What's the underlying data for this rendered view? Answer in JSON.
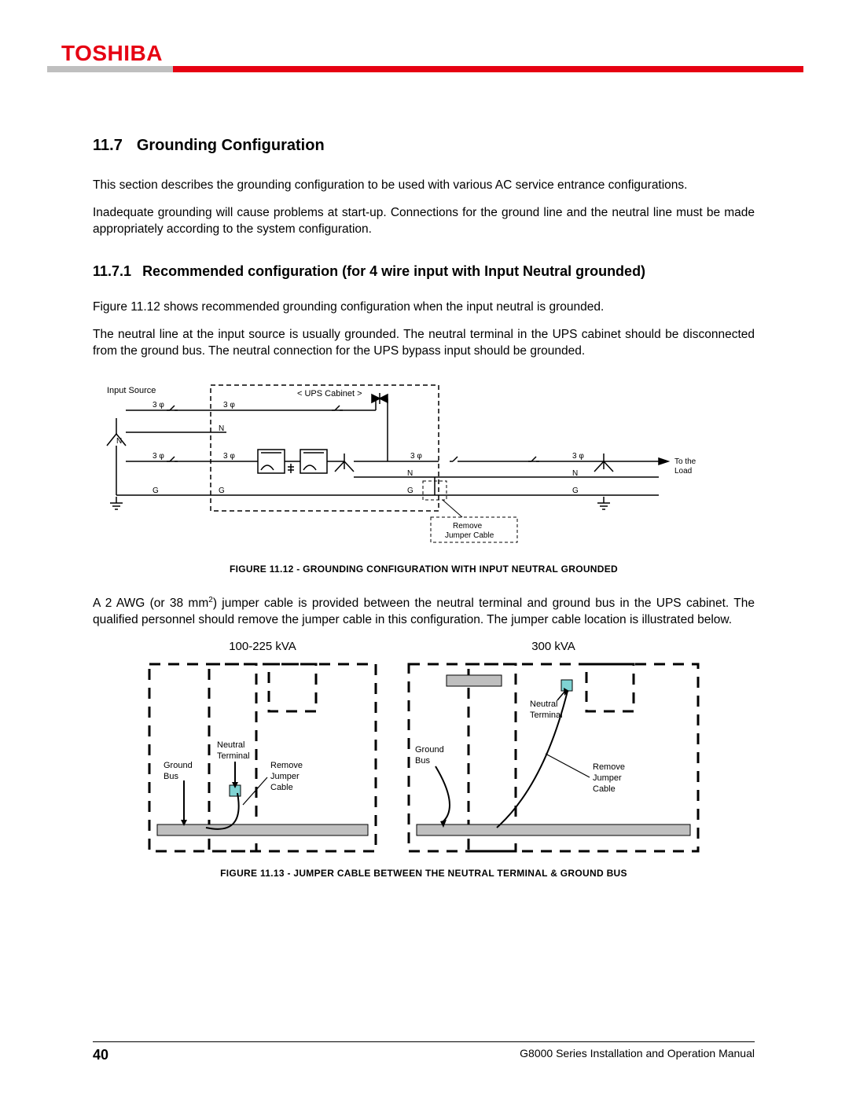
{
  "brand": "TOSHIBA",
  "section": {
    "number": "11.7",
    "title": "Grounding Configuration"
  },
  "subsection": {
    "number": "11.7.1",
    "title": "Recommended configuration (for 4 wire input with Input Neutral grounded)"
  },
  "para1": "This section describes the grounding configuration to be used with various AC service entrance configurations.",
  "para2": "Inadequate grounding will cause problems at start-up. Connections for the ground line and the neutral line must be made appropriately according to the system configuration.",
  "para3": "Figure 11.12 shows recommended grounding configuration when the input neutral is grounded.",
  "para4": "The neutral line at the input source is usually grounded. The neutral terminal in the UPS cabinet should be disconnected from the ground bus. The neutral connection for the UPS bypass input should be grounded.",
  "fig12caption": "FIGURE 11.12 - GROUNDING CONFIGURATION WITH INPUT NEUTRAL GROUNDED",
  "para5a": "A 2 AWG (or 38 mm",
  "para5b": ") jumper cable is provided between the neutral terminal and ground bus in the UPS cabinet. The qualified personnel should remove the jumper cable in this configuration. The jumper cable location is illustrated below.",
  "sup2": "2",
  "fig13caption": "FIGURE 11.13 - JUMPER CABLE BETWEEN THE NEUTRAL TERMINAL & GROUND BUS",
  "fig12": {
    "inputSource": "Input Source",
    "upsCabinet": "< UPS Cabinet >",
    "toLoad1": "To the",
    "toLoad2": "Load",
    "removeJumper1": "Remove",
    "removeJumper2": "Jumper Cable",
    "phi": "φ",
    "three": "3",
    "N": "N",
    "G": "G"
  },
  "fig13": {
    "left_kva": "100-225 kVA",
    "right_kva": "300 kVA",
    "groundBus": "Ground\nBus",
    "neutralTerminal": "Neutral\nTerminal",
    "removeJumper": "Remove\nJumper\nCable"
  },
  "footer": {
    "page": "40",
    "manual": "G8000 Series Installation and Operation Manual"
  }
}
